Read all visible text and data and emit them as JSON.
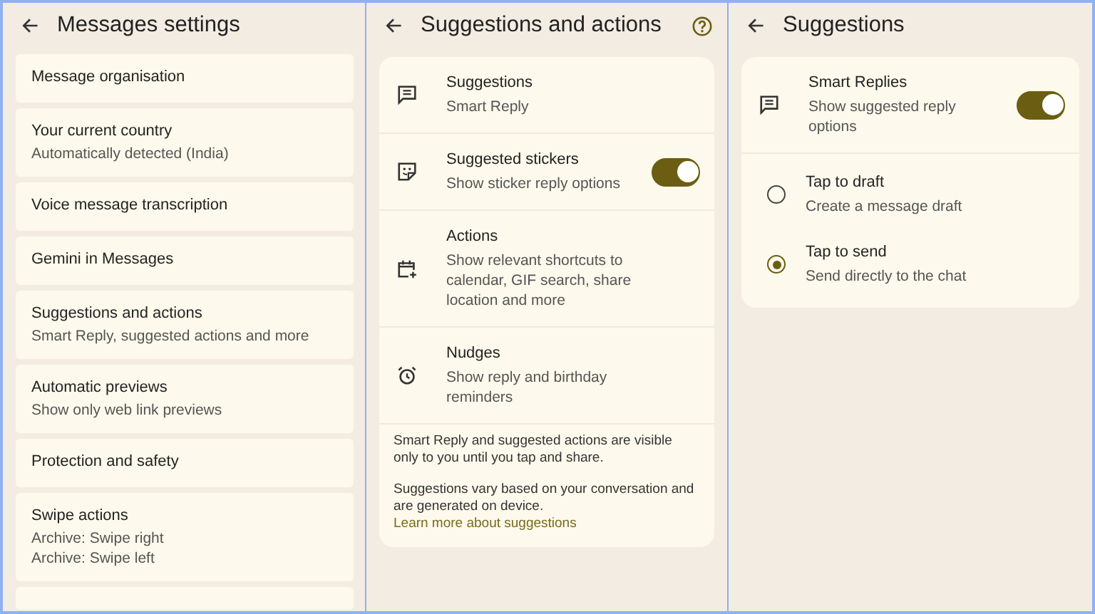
{
  "messages_settings": {
    "title": "Messages settings",
    "items": [
      {
        "title": "Message organisation"
      },
      {
        "title": "Your current country",
        "subtitles": [
          "Automatically detected (India)"
        ]
      },
      {
        "title": "Voice message transcription"
      },
      {
        "title": "Gemini in Messages"
      },
      {
        "title": "Suggestions and actions",
        "subtitles": [
          "Smart Reply, suggested actions and more"
        ]
      },
      {
        "title": "Automatic previews",
        "subtitles": [
          "Show only web link previews"
        ]
      },
      {
        "title": "Protection and safety"
      },
      {
        "title": "Swipe actions",
        "subtitles": [
          "Archive: Swipe right",
          "Archive: Swipe left"
        ]
      }
    ]
  },
  "suggestions_and_actions": {
    "title": "Suggestions and actions",
    "rows": [
      {
        "kind": "link",
        "title": "Suggestions",
        "subtitle": "Smart Reply"
      },
      {
        "kind": "toggle",
        "title": "Suggested stickers",
        "subtitle": "Show sticker reply options",
        "on": true
      },
      {
        "kind": "link",
        "title": "Actions",
        "subtitle": "Show relevant shortcuts to calendar, GIF search, share location and more"
      },
      {
        "kind": "link",
        "title": "Nudges",
        "subtitle": "Show reply and birthday reminders"
      }
    ],
    "note": "Smart Reply and suggested actions are visible only to you until you tap and share.",
    "note_2": "Suggestions vary based on your conversation and are generated on device.",
    "note_link": "Learn more about suggestions"
  },
  "suggestions": {
    "title": "Suggestions",
    "smart_replies": {
      "title": "Smart Replies",
      "subtitle": "Show suggested reply options",
      "on": true
    },
    "options": [
      {
        "title": "Tap to draft",
        "subtitle": "Create a message draft",
        "selected": false
      },
      {
        "title": "Tap to send",
        "subtitle": "Send directly to the chat",
        "selected": true
      }
    ]
  }
}
